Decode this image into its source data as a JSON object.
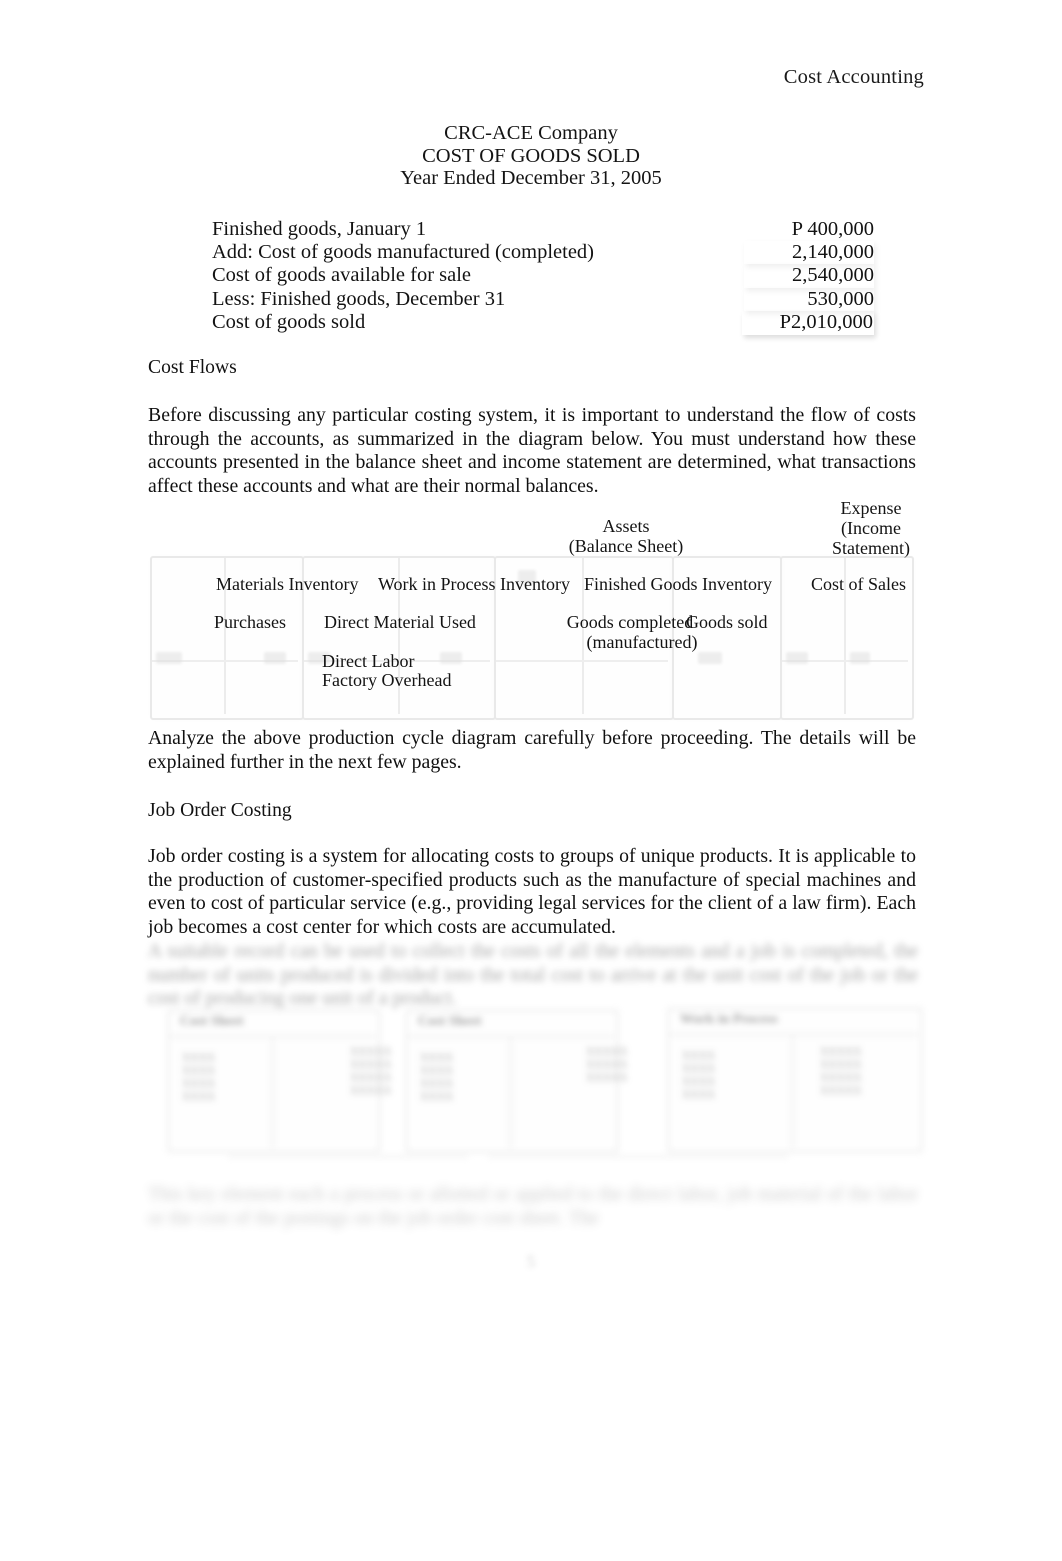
{
  "header": {
    "running_title": "Cost Accounting"
  },
  "statement": {
    "company": "CRC-ACE Company",
    "title": "COST OF GOODS SOLD",
    "period": "Year Ended December 31, 2005",
    "rows": [
      {
        "label": "Finished goods, January 1",
        "amount": "P   400,000"
      },
      {
        "label": "Add: Cost of goods manufactured (completed)",
        "amount": "2,140,000"
      },
      {
        "label": "Cost of goods available for sale",
        "amount": "2,540,000"
      },
      {
        "label": "Less: Finished goods, December 31",
        "amount": "530,000"
      },
      {
        "label": "Cost of goods sold",
        "amount": "P2,010,000"
      }
    ]
  },
  "sections": {
    "cost_flows": {
      "heading": "Cost Flows",
      "paragraph": "Before discussing any particular costing system, it is important to understand the flow of costs through the accounts, as summarized in the diagram below. You must understand how these accounts presented in the balance sheet and income statement are determined, what transactions affect these accounts and what are their normal balances.",
      "after_diagram_paragraph": "Analyze the above production cycle diagram carefully before proceeding. The details will be explained further in the next few pages."
    },
    "job_order_costing": {
      "heading": "Job Order Costing",
      "paragraph": "Job order costing is a system for allocating costs to groups of unique products. It is applicable to the production of customer-specified products such as the manufacture of special machines and even to cost of particular service (e.g., providing legal services for the client of a law firm). Each job becomes a cost center for which costs are accumulated."
    }
  },
  "flow_diagram": {
    "group_headings": [
      {
        "line1": "Assets",
        "line2": "(Balance Sheet)"
      },
      {
        "line1": "Expense",
        "line2": "(Income",
        "line3": "Statement)"
      }
    ],
    "accounts": [
      "Materials Inventory",
      "Work in Process Inventory",
      "Finished Goods Inventory",
      "Cost of Sales"
    ],
    "entries": {
      "purchases": "Purchases",
      "direct_material_used": "Direct Material Used",
      "direct_labor": "Direct Labor",
      "factory_overhead": "Factory Overhead",
      "goods_completed": "Goods completed",
      "goods_completed_sub": "(manufactured)",
      "goods_sold": "Goods sold"
    }
  },
  "blurred_content": {
    "paragraph_1": "A suitable record can be used to collect the costs of all the elements and a job is completed, the number of units produced is divided into the total cost to arrive at the unit cost of the job or the cost of producing one unit of a product.",
    "paragraph_2": "This key element each a process or allotted or applied to the direct labor, job material of the labor or the cost of the postings on the job order cost sheet. The",
    "card_headings": [
      "Cost Sheet",
      "Cost Sheet",
      "Work in Process"
    ],
    "page_number": "5"
  },
  "colors": {
    "page_background": "#ffffff",
    "text": "#111111",
    "diagram_rule": "#bdbdbd",
    "faded_text": "#5a5a5a"
  }
}
